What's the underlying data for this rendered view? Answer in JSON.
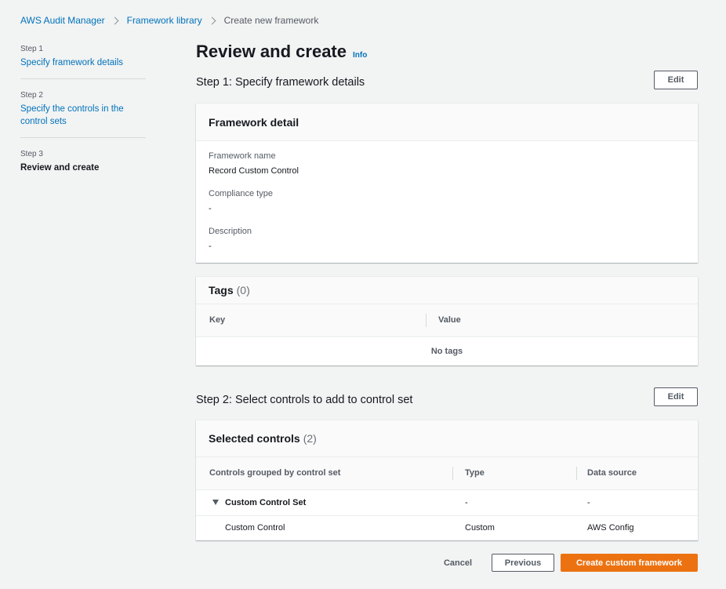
{
  "breadcrumb": {
    "items": [
      "AWS Audit Manager",
      "Framework library"
    ],
    "current": "Create new framework"
  },
  "steps": [
    {
      "num": "Step 1",
      "label": "Specify framework details"
    },
    {
      "num": "Step 2",
      "label": "Specify the controls in the control sets"
    },
    {
      "num": "Step 3",
      "label": "Review and create"
    }
  ],
  "page": {
    "title": "Review and create",
    "info": "Info"
  },
  "step1": {
    "heading": "Step 1: Specify framework details",
    "edit_label": "Edit"
  },
  "framework_detail": {
    "title": "Framework detail",
    "fields": [
      {
        "key": "Framework name",
        "value": "Record Custom Control"
      },
      {
        "key": "Compliance type",
        "value": "-"
      },
      {
        "key": "Description",
        "value": "-"
      }
    ]
  },
  "tags": {
    "title": "Tags",
    "count": "(0)",
    "columns": [
      "Key",
      "Value"
    ],
    "empty": "No tags"
  },
  "step2": {
    "heading": "Step 2: Select controls to add to control set",
    "edit_label": "Edit"
  },
  "selected_controls": {
    "title": "Selected controls",
    "count": "(2)",
    "columns": [
      "Controls grouped by control set",
      "Type",
      "Data source"
    ],
    "group": {
      "name": "Custom Control Set",
      "type": "-",
      "source": "-"
    },
    "rows": [
      {
        "name": "Custom Control",
        "type": "Custom",
        "source": "AWS Config"
      }
    ]
  },
  "footer": {
    "cancel": "Cancel",
    "previous": "Previous",
    "create": "Create custom framework"
  },
  "colors": {
    "accent": "#ec7211",
    "link": "#0073bb"
  }
}
